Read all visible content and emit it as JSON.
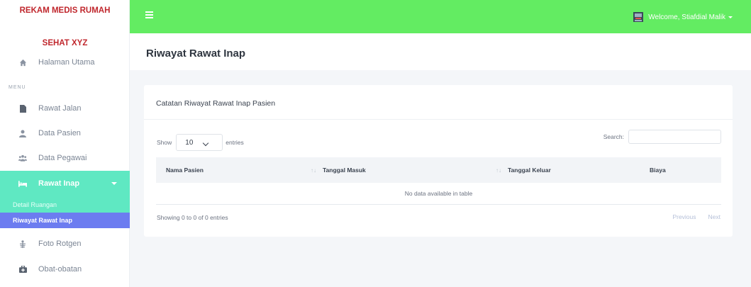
{
  "sidebar": {
    "brand_line1": "REKAM MEDIS RUMAH",
    "brand_line2": "SEHAT XYZ",
    "menu_heading": "MENU",
    "items": [
      {
        "label": "Halaman Utama",
        "icon": "home-icon"
      },
      {
        "label": "Rawat Jalan",
        "icon": "file-icon"
      },
      {
        "label": "Data Pasien",
        "icon": "user-icon"
      },
      {
        "label": "Data Pegawai",
        "icon": "users-icon"
      },
      {
        "label": "Rawat Inap",
        "icon": "bed-icon"
      },
      {
        "label": "Foto Rotgen",
        "icon": "xray-icon"
      },
      {
        "label": "Obat-obatan",
        "icon": "medkit-icon"
      }
    ],
    "submenu": [
      {
        "label": "Detail Ruangan"
      },
      {
        "label": "Riwayat Rawat Inap"
      }
    ]
  },
  "topbar": {
    "user_label": "Welcome, Stiafdial Malik",
    "accent": "#63ec62"
  },
  "page": {
    "title": "Riwayat Rawat Inap"
  },
  "card": {
    "title": "Catatan Riwayat Rawat Inap Pasien",
    "show_label": "Show",
    "entries_value": "10",
    "entries_label": "entries",
    "search_label": "Search:",
    "columns": [
      "Nama Pasien",
      "Tanggal Masuk",
      "Tanggal Keluar",
      "Biaya"
    ],
    "empty_text": "No data available in table",
    "info_text": "Showing 0 to 0 of 0 entries",
    "prev_label": "Previous",
    "next_label": "Next"
  },
  "colors": {
    "active_menu": "#5fe8c2",
    "active_submenu": "#6c7cf0",
    "brand": "#c0272d"
  }
}
